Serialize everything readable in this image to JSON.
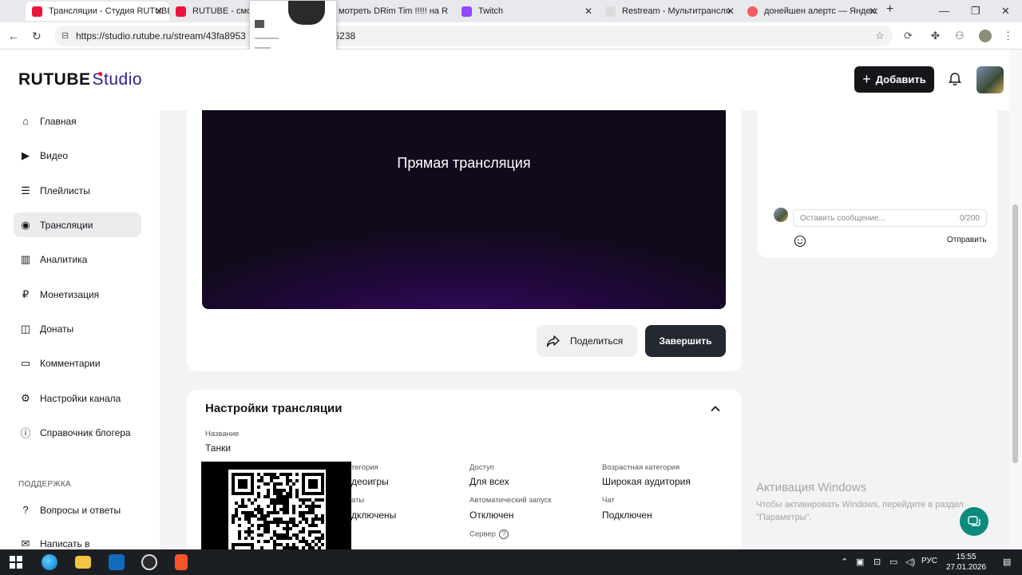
{
  "browser": {
    "tabs": [
      {
        "label": "Трансляции - Студия RUTUBE",
        "color": "#ed143b",
        "active": true
      },
      {
        "label": "RUTUBE - смотр",
        "color": "#ed143b",
        "active": false
      },
      {
        "label": "мотреть DRim Tim !!!!! на R",
        "color": "#ed143b",
        "active": false
      },
      {
        "label": "Twitch",
        "color": "#9146ff",
        "active": false
      },
      {
        "label": "Restream - Мультитрансля",
        "color": "#dcdcdc",
        "active": false
      },
      {
        "label": "донейшен алертс — Яндекс",
        "color": "#f15c5c",
        "active": false
      }
    ],
    "url": "https://studio.rutube.ru/stream/43fa8953",
    "url_tail": "96238"
  },
  "header": {
    "logo_main": "RUTUBE",
    "logo_sub": "Studio",
    "add_label": "Добавить"
  },
  "sidebar": {
    "items": [
      {
        "label": "Главная",
        "icon": "home-icon",
        "glyph": "⌂"
      },
      {
        "label": "Видео",
        "icon": "video-icon",
        "glyph": "▶"
      },
      {
        "label": "Плейлисты",
        "icon": "playlist-icon",
        "glyph": "☰"
      },
      {
        "label": "Трансляции",
        "icon": "broadcast-icon",
        "glyph": "◉"
      },
      {
        "label": "Аналитика",
        "icon": "analytics-icon",
        "glyph": "▥"
      },
      {
        "label": "Монетизация",
        "icon": "monetization-icon",
        "glyph": "₽"
      },
      {
        "label": "Донаты",
        "icon": "donate-icon",
        "glyph": "◫"
      },
      {
        "label": "Комментарии",
        "icon": "comments-icon",
        "glyph": "▭"
      },
      {
        "label": "Настройки канала",
        "icon": "settings-icon",
        "glyph": "⚙"
      },
      {
        "label": "Справочник блогера",
        "icon": "info-icon",
        "glyph": "ⓘ"
      }
    ],
    "support_section": "ПОДДЕРЖКА",
    "support_items": [
      {
        "label": "Вопросы и ответы",
        "icon": "faq-icon",
        "glyph": "?"
      },
      {
        "label": "Написать в",
        "icon": "write-icon",
        "glyph": "✉"
      }
    ]
  },
  "player": {
    "title": "Прямая трансляция"
  },
  "actions": {
    "share_label": "Поделиться",
    "finish_label": "Завершить"
  },
  "settings": {
    "title": "Настройки трансляции",
    "name_label": "Название",
    "name_value": "Танки",
    "category_label": "тегория",
    "category_value": "деоигры",
    "donations_label": "аты",
    "donations_value": "дключены",
    "access_label": "Доступ",
    "access_value": "Для всех",
    "age_label": "Возрастная категория",
    "age_value": "Широкая аудитория",
    "autostart_label": "Автоматический запуск",
    "autostart_value": "Отключен",
    "chat_label": "Чат",
    "chat_value": "Подключен",
    "server_label": "Сервер"
  },
  "chat": {
    "placeholder": "Оставить сообщение...",
    "counter": "0/200",
    "send_label": "Отправить"
  },
  "watermark": {
    "title": "Активация Windows",
    "text": "Чтобы активировать Windows, перейдите в раздел \"Параметры\"."
  },
  "taskbar": {
    "lang": "РУС",
    "time": "15:55",
    "date": "27.01.2026"
  }
}
